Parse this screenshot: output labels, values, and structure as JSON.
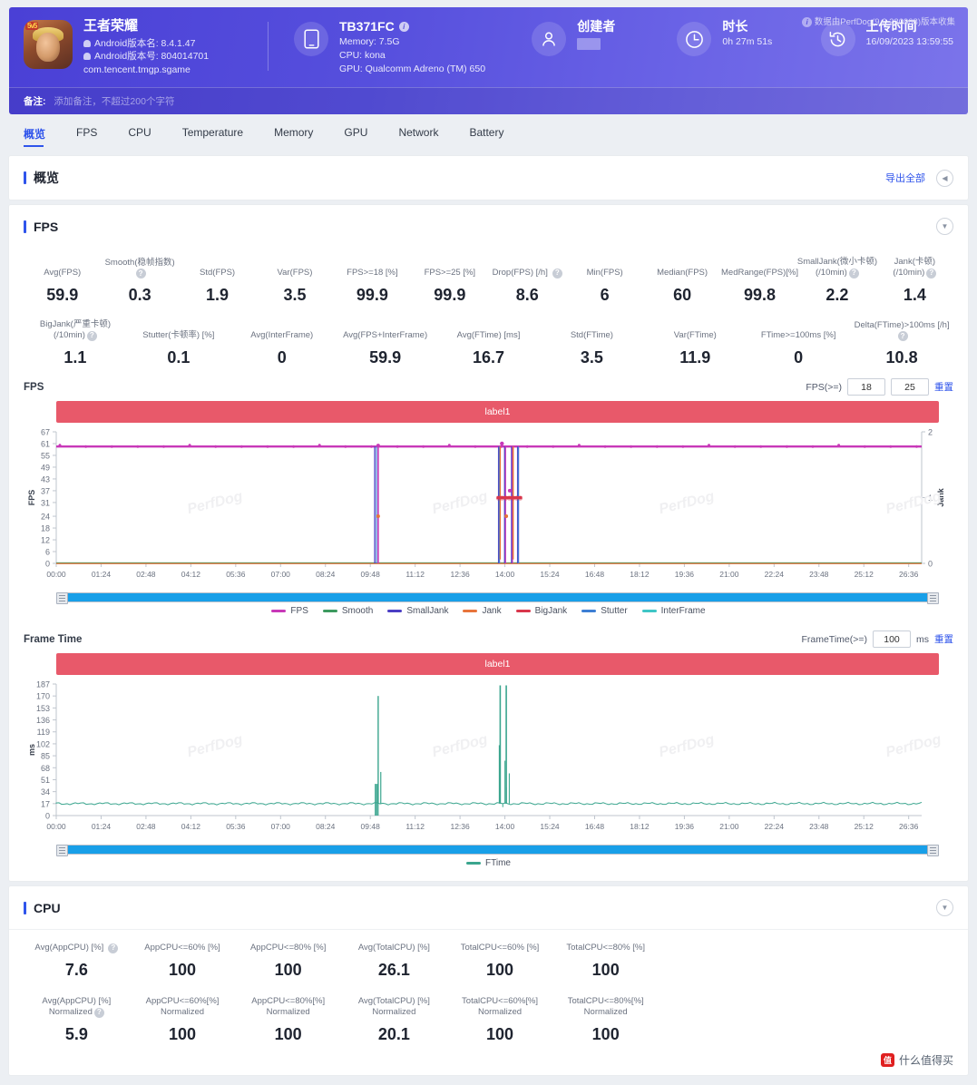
{
  "header": {
    "app": {
      "icon_badge": "5v5",
      "name": "王者荣耀",
      "android_version_name": "Android版本名: 8.4.1.47",
      "android_version_code": "Android版本号: 804014701",
      "package": "com.tencent.tmgp.sgame"
    },
    "device": {
      "model": "TB371FC",
      "memory": "Memory: 7.5G",
      "cpu": "CPU: kona",
      "gpu": "GPU: Qualcomm Adreno (TM) 650"
    },
    "creator": {
      "title": "创建者",
      "value": ""
    },
    "duration": {
      "title": "时长",
      "value": "0h 27m 51s"
    },
    "upload": {
      "title": "上传时间",
      "value": "16/09/2023 13:59:55"
    },
    "collector_note": "数据由PerfDog(9.2.230908)版本收集",
    "remark_label": "备注:",
    "remark_placeholder": "添加备注，不超过200个字符"
  },
  "tabs": [
    {
      "label": "概览",
      "active": true
    },
    {
      "label": "FPS",
      "active": false
    },
    {
      "label": "CPU",
      "active": false
    },
    {
      "label": "Temperature",
      "active": false
    },
    {
      "label": "Memory",
      "active": false
    },
    {
      "label": "GPU",
      "active": false
    },
    {
      "label": "Network",
      "active": false
    },
    {
      "label": "Battery",
      "active": false
    }
  ],
  "overview": {
    "title": "概览",
    "export_all": "导出全部",
    "collapse_icon": "chevron-left-icon"
  },
  "fps_section": {
    "title": "FPS",
    "metrics_row1": [
      {
        "label": "Avg(FPS)",
        "value": "59.9",
        "help": false
      },
      {
        "label": "Smooth(稳帧指数)",
        "value": "0.3",
        "help": true
      },
      {
        "label": "Std(FPS)",
        "value": "1.9",
        "help": false
      },
      {
        "label": "Var(FPS)",
        "value": "3.5",
        "help": false
      },
      {
        "label": "FPS>=18 [%]",
        "value": "99.9",
        "help": false
      },
      {
        "label": "FPS>=25 [%]",
        "value": "99.9",
        "help": false
      },
      {
        "label": "Drop(FPS) [/h]",
        "value": "8.6",
        "help": true
      },
      {
        "label": "Min(FPS)",
        "value": "6",
        "help": false
      },
      {
        "label": "Median(FPS)",
        "value": "60",
        "help": false
      },
      {
        "label": "MedRange(FPS)[%]",
        "value": "99.8",
        "help": false
      },
      {
        "label": "SmallJank(微小卡顿)",
        "sub": "(/10min)",
        "value": "2.2",
        "help": true
      },
      {
        "label": "Jank(卡顿)",
        "sub": "(/10min)",
        "value": "1.4",
        "help": true
      }
    ],
    "metrics_row2": [
      {
        "label": "BigJank(严重卡顿)",
        "sub": "(/10min)",
        "value": "1.1",
        "help": true
      },
      {
        "label": "Stutter(卡顿率) [%]",
        "value": "0.1",
        "help": false
      },
      {
        "label": "Avg(InterFrame)",
        "value": "0",
        "help": false
      },
      {
        "label": "Avg(FPS+InterFrame)",
        "value": "59.9",
        "help": false
      },
      {
        "label": "Avg(FTime) [ms]",
        "value": "16.7",
        "help": false
      },
      {
        "label": "Std(FTime)",
        "value": "3.5",
        "help": false
      },
      {
        "label": "Var(FTime)",
        "value": "11.9",
        "help": false
      },
      {
        "label": "FTime>=100ms [%]",
        "value": "0",
        "help": false
      },
      {
        "label": "Delta(FTime)>100ms [/h]",
        "value": "10.8",
        "help": true
      }
    ]
  },
  "fps_chart": {
    "name": "FPS",
    "ctrl_label": "FPS(>=)",
    "threshold_low": "18",
    "threshold_high": "25",
    "reset": "重置",
    "series_label": "label1"
  },
  "frametime_chart": {
    "name": "Frame Time",
    "ctrl_label": "FrameTime(>=)",
    "threshold": "100",
    "unit": "ms",
    "reset": "重置",
    "series_label": "label1"
  },
  "cpu_section": {
    "title": "CPU",
    "metrics_row1": [
      {
        "label": "Avg(AppCPU) [%]",
        "value": "7.6",
        "help": true
      },
      {
        "label": "AppCPU<=60% [%]",
        "value": "100",
        "help": false
      },
      {
        "label": "AppCPU<=80% [%]",
        "value": "100",
        "help": false
      },
      {
        "label": "Avg(TotalCPU) [%]",
        "value": "26.1",
        "help": false
      },
      {
        "label": "TotalCPU<=60% [%]",
        "value": "100",
        "help": false
      },
      {
        "label": "TotalCPU<=80% [%]",
        "value": "100",
        "help": false
      }
    ],
    "metrics_row2": [
      {
        "label": "Avg(AppCPU) [%]",
        "sub": "Normalized",
        "value": "5.9",
        "help": true
      },
      {
        "label": "AppCPU<=60%[%]",
        "sub": "Normalized",
        "value": "100",
        "help": false
      },
      {
        "label": "AppCPU<=80%[%]",
        "sub": "Normalized",
        "value": "100",
        "help": false
      },
      {
        "label": "Avg(TotalCPU) [%]",
        "sub": "Normalized",
        "value": "20.1",
        "help": false
      },
      {
        "label": "TotalCPU<=60%[%]",
        "sub": "Normalized",
        "value": "100",
        "help": false
      },
      {
        "label": "TotalCPU<=80%[%]",
        "sub": "Normalized",
        "value": "100",
        "help": false
      }
    ]
  },
  "brand": {
    "mark": "值",
    "text": "什么值得买"
  },
  "colors": {
    "accent": "#2f54eb",
    "header_gradient_from": "#4a40d6",
    "header_gradient_to": "#7b74ea",
    "label_bar": "#e8596a",
    "scrollbar": "#189fe8"
  },
  "chart_data": [
    {
      "type": "line",
      "title": "FPS",
      "series_label": "label1",
      "xlabel": "",
      "ylabel": "FPS",
      "y2label": "Jank",
      "ylim": [
        0,
        67
      ],
      "y2lim": [
        0,
        2
      ],
      "yticks": [
        0,
        6,
        12,
        18,
        24,
        31,
        37,
        43,
        49,
        55,
        61,
        67
      ],
      "y2ticks": [
        0,
        1,
        2
      ],
      "xticks": [
        "00:00",
        "01:24",
        "02:48",
        "04:12",
        "05:36",
        "07:00",
        "08:24",
        "09:48",
        "11:12",
        "12:36",
        "14:00",
        "15:24",
        "16:48",
        "18:12",
        "19:36",
        "21:00",
        "22:24",
        "23:48",
        "25:12",
        "26:36"
      ],
      "grid": false,
      "legend_position": "bottom",
      "legend": [
        "FPS",
        "Smooth",
        "SmallJank",
        "Jank",
        "BigJank",
        "Stutter",
        "InterFrame"
      ],
      "series": [
        {
          "name": "FPS",
          "color": "#c838b8",
          "description": "Flat near 59-60 FPS for the whole run with sharp drops to ~6 at 10:20 and several drops between 14:05 and 14:40",
          "values_summary": {
            "avg": 59.9,
            "min": 6,
            "median": 60,
            "max": 61
          }
        },
        {
          "name": "Smooth",
          "color": "#3c9a5f",
          "description": "Flat at 0 across the run",
          "values_summary": {
            "avg": 0.3
          }
        },
        {
          "name": "SmallJank",
          "color": "#4b3fc4",
          "description": "Zero except isolated spikes to 1 near 10:20 and 14:05-14:40",
          "values_summary": {
            "per10min": 2.2
          }
        },
        {
          "name": "Jank",
          "color": "#e8743b",
          "description": "Zero baseline with spikes to 1 near 14:10 and 14:30",
          "values_summary": {
            "per10min": 1.4
          }
        },
        {
          "name": "BigJank",
          "color": "#d9364c",
          "description": "Zero baseline with a cluster of points at level ~1 around 14:05-14:35",
          "values_summary": {
            "per10min": 1.1
          }
        },
        {
          "name": "Stutter",
          "color": "#3d7fd4",
          "description": "Zero baseline with thin spikes near 10:20 and 14:10-14:35",
          "values_summary": {
            "pct": 0.1
          }
        },
        {
          "name": "InterFrame",
          "color": "#3fc6c6",
          "description": "Flat at 0 across the run",
          "values_summary": {
            "avg": 0
          }
        }
      ]
    },
    {
      "type": "line",
      "title": "Frame Time",
      "series_label": "label1",
      "xlabel": "",
      "ylabel": "ms",
      "ylim": [
        0,
        187
      ],
      "yticks": [
        0,
        17,
        34,
        51,
        68,
        85,
        102,
        119,
        136,
        153,
        170,
        187
      ],
      "xticks": [
        "00:00",
        "01:24",
        "02:48",
        "04:12",
        "05:36",
        "07:00",
        "08:24",
        "09:48",
        "11:12",
        "12:36",
        "14:00",
        "15:24",
        "16:48",
        "18:12",
        "19:36",
        "21:00",
        "22:24",
        "23:48",
        "25:12",
        "26:36"
      ],
      "grid": false,
      "legend_position": "bottom",
      "legend": [
        "FTime"
      ],
      "series": [
        {
          "name": "FTime",
          "color": "#3aa58e",
          "description": "Baseline ~17 ms with a spike to ~170 ms near 10:25, a small spike to ~40 ms near 12:30, and two spikes to ~185 ms near 14:05 and 14:25",
          "values_summary": {
            "avg": 16.7,
            "std": 3.5,
            "var": 11.9,
            "max": 185
          }
        }
      ]
    }
  ]
}
